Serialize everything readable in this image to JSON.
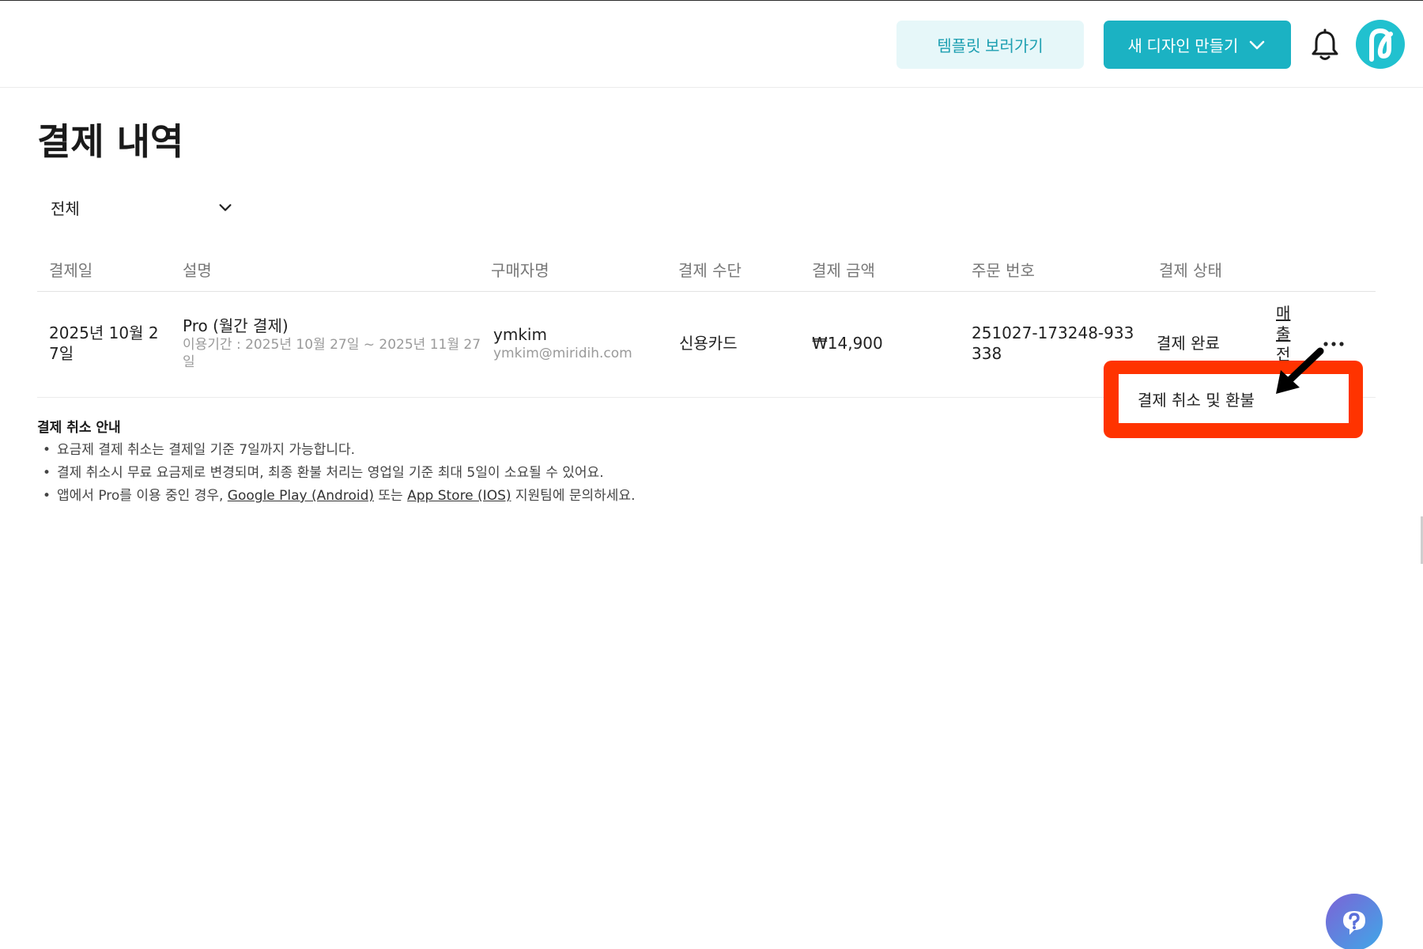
{
  "header": {
    "template_button": "템플릿 보러가기",
    "new_design_button": "새 디자인 만들기"
  },
  "page": {
    "title": "결제 내역",
    "filter": {
      "selected": "전체"
    }
  },
  "table": {
    "columns": [
      "결제일",
      "설명",
      "구매자명",
      "결제 수단",
      "결제 금액",
      "주문 번호",
      "결제 상태"
    ],
    "rows": [
      {
        "date_line1": "2025년 10월 2",
        "date_line2": "7일",
        "plan": "Pro (월간 결제)",
        "period_line1": "이용기간 : 2025년 10월 27일 ~ 2025년 11월 27",
        "period_line2": "일",
        "buyer_name": "ymkim",
        "buyer_email": "ymkim@miridih.com",
        "payment_method": "신용카드",
        "amount": "₩14,900",
        "order_no_line1": "251027-173248-933",
        "order_no_line2": "338",
        "status": "결제 완료",
        "receipt_chars": [
          "매",
          "출",
          "전"
        ]
      }
    ]
  },
  "dropdown_menu": {
    "item": "결제 취소 및 환불"
  },
  "notice": {
    "title": "결제 취소 안내",
    "item1": "요금제 결제 취소는 결제일 기준 7일까지 가능합니다.",
    "item2": "결제 취소시 무료 요금제로 변경되며, 최종 환불 처리는 영업일 기준 최대 5일이 소요될 수 있어요.",
    "item3_prefix": "앱에서 Pro를 이용 중인 경우, ",
    "item3_link1": "Google Play (Android)",
    "item3_mid": " 또는 ",
    "item3_link2": "App Store (IOS)",
    "item3_suffix": " 지원팀에 문의하세요."
  },
  "colors": {
    "accent": "#1bb2c3",
    "accent_light": "#e6f7f9",
    "highlight": "#ff3300"
  }
}
